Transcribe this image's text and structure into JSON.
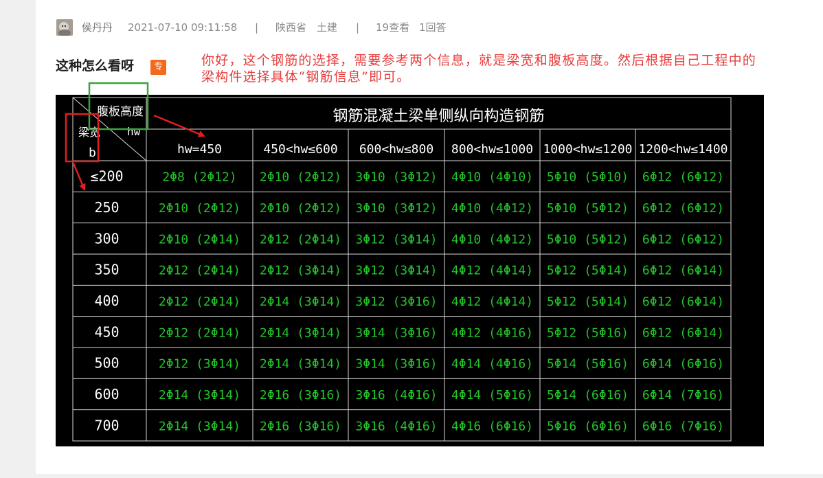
{
  "post": {
    "author": "侯丹丹",
    "datetime": "2021-07-10 09:11:58",
    "sep1": "|",
    "region": "陕西省",
    "category": "土建",
    "sep2": "|",
    "views": "19查看",
    "answers": "1回答",
    "title": "这种怎么看呀",
    "badge": "专",
    "answer_note": "你好，这个钢筋的选择，需要参考两个信息，就是梁宽和腹板高度。然后根据自己工程中的梁构件选择具体“钢筋信息”即可。"
  },
  "table": {
    "title": "钢筋混凝土梁单侧纵向构造钢筋",
    "corner_top": "腹板高度",
    "corner_hw": "hw",
    "corner_left": "梁宽",
    "corner_b": "b",
    "columns": [
      "hw=450",
      "450<hw≤600",
      "600<hw≤800",
      "800<hw≤1000",
      "1000<hw≤1200",
      "1200<hw≤1400"
    ],
    "rows": [
      {
        "width": "≤200",
        "cells": [
          "2Φ8  (2Φ12)",
          "2Φ10  (2Φ12)",
          "3Φ10  (3Φ12)",
          "4Φ10  (4Φ10)",
          "5Φ10  (5Φ10)",
          "6Φ12  (6Φ12)"
        ]
      },
      {
        "width": "250",
        "cells": [
          "2Φ10  (2Φ12)",
          "2Φ10  (2Φ12)",
          "3Φ10  (3Φ12)",
          "4Φ10  (4Φ12)",
          "5Φ10  (5Φ12)",
          "6Φ12  (6Φ12)"
        ]
      },
      {
        "width": "300",
        "cells": [
          "2Φ10  (2Φ14)",
          "2Φ12  (2Φ14)",
          "3Φ12  (3Φ14)",
          "4Φ10  (4Φ12)",
          "5Φ10  (5Φ12)",
          "6Φ12  (6Φ12)"
        ]
      },
      {
        "width": "350",
        "cells": [
          "2Φ12  (2Φ14)",
          "2Φ12  (3Φ14)",
          "3Φ12  (3Φ14)",
          "4Φ12  (4Φ14)",
          "5Φ12  (5Φ14)",
          "6Φ12  (6Φ14)"
        ]
      },
      {
        "width": "400",
        "cells": [
          "2Φ12  (2Φ14)",
          "2Φ14  (3Φ14)",
          "3Φ12  (3Φ16)",
          "4Φ12  (4Φ14)",
          "5Φ12  (5Φ14)",
          "6Φ12  (6Φ14)"
        ]
      },
      {
        "width": "450",
        "cells": [
          "2Φ12  (2Φ14)",
          "2Φ14  (3Φ14)",
          "3Φ14  (3Φ16)",
          "4Φ12  (4Φ16)",
          "5Φ12  (5Φ16)",
          "6Φ12  (6Φ14)"
        ]
      },
      {
        "width": "500",
        "cells": [
          "2Φ12  (3Φ14)",
          "2Φ14  (3Φ14)",
          "3Φ14  (3Φ16)",
          "4Φ14  (4Φ16)",
          "5Φ14  (5Φ16)",
          "6Φ14  (6Φ16)"
        ]
      },
      {
        "width": "600",
        "cells": [
          "2Φ14  (3Φ14)",
          "2Φ16  (3Φ16)",
          "3Φ16  (4Φ16)",
          "4Φ14  (5Φ16)",
          "5Φ14  (6Φ16)",
          "6Φ14  (7Φ16)"
        ]
      },
      {
        "width": "700",
        "cells": [
          "2Φ14  (3Φ14)",
          "2Φ16  (3Φ16)",
          "3Φ16  (4Φ16)",
          "4Φ16  (6Φ16)",
          "5Φ16  (6Φ16)",
          "6Φ16  (7Φ16)"
        ]
      }
    ]
  },
  "colors": {
    "cell_text": "#22c42a",
    "header_text": "#ffffff",
    "grid": "#d8d8d8",
    "background": "#000000",
    "note_text": "#e63c3c",
    "highlight_red": "#e02020",
    "highlight_green": "#3aa53a",
    "badge": "#f26a1b"
  }
}
